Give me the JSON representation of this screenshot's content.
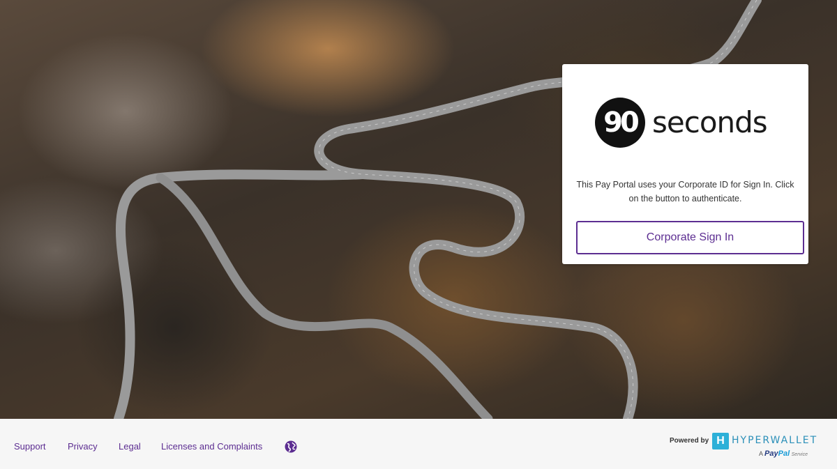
{
  "brand": {
    "logo_mark": "90",
    "logo_text": "seconds"
  },
  "card": {
    "message": "This Pay Portal uses your Corporate ID for Sign In. Click on the button to authenticate.",
    "signin_label": "Corporate Sign In"
  },
  "footer": {
    "links": [
      {
        "label": "Support"
      },
      {
        "label": "Privacy"
      },
      {
        "label": "Legal"
      },
      {
        "label": "Licenses and Complaints"
      }
    ],
    "language_icon": "globe-icon",
    "powered_by": "Powered by",
    "provider_name": "HYPERWALLET",
    "provider_mark": "H",
    "provider_sub_prefix": "A",
    "provider_sub_brand_1": "Pay",
    "provider_sub_brand_2": "Pal",
    "provider_sub_suffix": "Service"
  },
  "colors": {
    "accent": "#5c2d91",
    "hyperwallet": "#2db0d8"
  }
}
